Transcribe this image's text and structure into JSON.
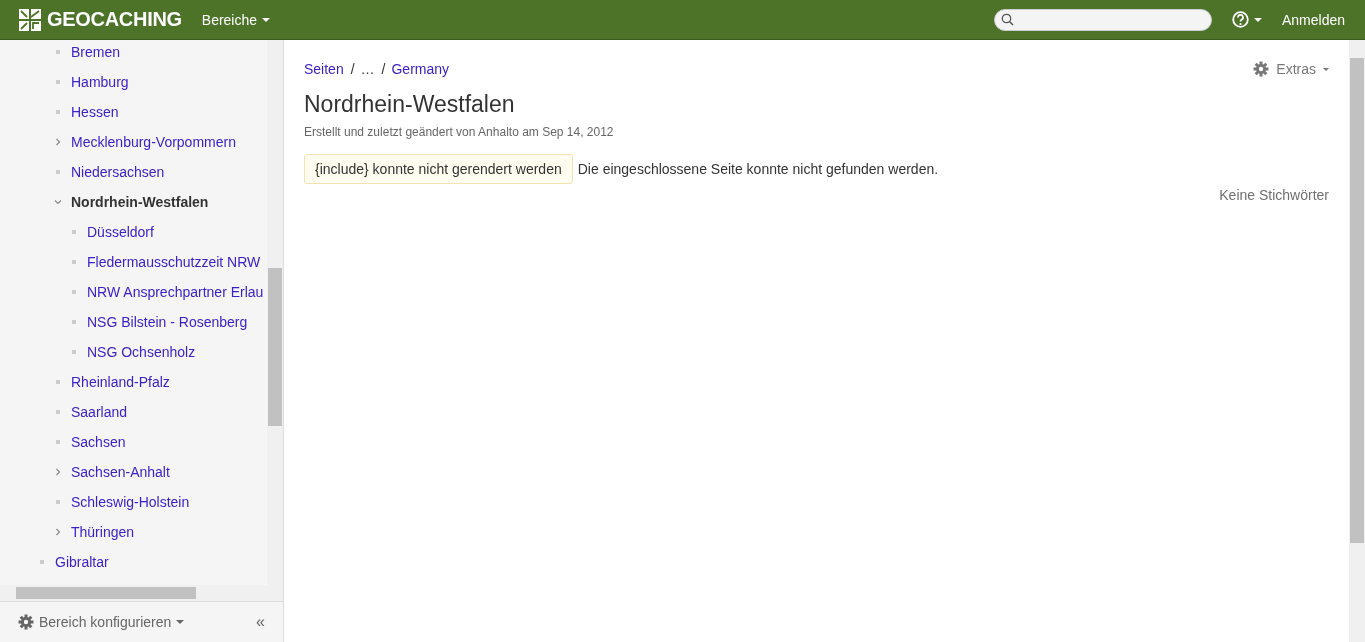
{
  "header": {
    "logo": "GEOCACHING",
    "menu": "Bereiche",
    "login": "Anmelden"
  },
  "sidebar": {
    "tree": [
      {
        "children": [
          {
            "label": "Bremen",
            "kind": "page",
            "selected": false
          },
          {
            "label": "Hamburg",
            "kind": "page",
            "selected": false
          },
          {
            "label": "Hessen",
            "kind": "page",
            "selected": false
          },
          {
            "label": "Mecklenburg-Vorpommern",
            "kind": "folder",
            "expanded": false,
            "selected": false
          },
          {
            "label": "Niedersachsen",
            "kind": "page",
            "selected": false
          },
          {
            "label": "Nordrhein-Westfalen",
            "kind": "folder",
            "expanded": true,
            "selected": true,
            "children": [
              {
                "label": "Düsseldorf",
                "kind": "page",
                "selected": false
              },
              {
                "label": "Fledermausschutzzeit NRW",
                "kind": "page",
                "selected": false
              },
              {
                "label": "NRW Ansprechpartner Erlau",
                "kind": "page",
                "selected": false
              },
              {
                "label": "NSG Bilstein - Rosenberg",
                "kind": "page",
                "selected": false
              },
              {
                "label": "NSG Ochsenholz",
                "kind": "page",
                "selected": false
              }
            ]
          },
          {
            "label": "Rheinland-Pfalz",
            "kind": "page",
            "selected": false
          },
          {
            "label": "Saarland",
            "kind": "page",
            "selected": false
          },
          {
            "label": "Sachsen",
            "kind": "page",
            "selected": false
          },
          {
            "label": "Sachsen-Anhalt",
            "kind": "folder",
            "expanded": false,
            "selected": false
          },
          {
            "label": "Schleswig-Holstein",
            "kind": "page",
            "selected": false
          },
          {
            "label": "Thüringen",
            "kind": "folder",
            "expanded": false,
            "selected": false
          }
        ]
      },
      {
        "label": "Gibraltar",
        "kind": "page",
        "selected": false
      }
    ],
    "configure": "Bereich konfigurieren",
    "collapse": "«"
  },
  "breadcrumbs": [
    {
      "label": "Seiten",
      "kind": "link"
    },
    {
      "label": "/",
      "kind": "separator"
    },
    {
      "label": "…",
      "kind": "text"
    },
    {
      "label": "/",
      "kind": "separator"
    },
    {
      "label": "Germany",
      "kind": "link"
    }
  ],
  "extras": "Extras",
  "title": "Nordrhein-Westfalen",
  "meta": "Erstellt und zuletzt geändert von Anhalto am Sep 14, 2012",
  "error": {
    "label": "{include} konnte nicht gerendert werden",
    "message": "Die eingeschlossene Seite konnte nicht gefunden werden."
  },
  "labels": "Keine Stichwörter"
}
